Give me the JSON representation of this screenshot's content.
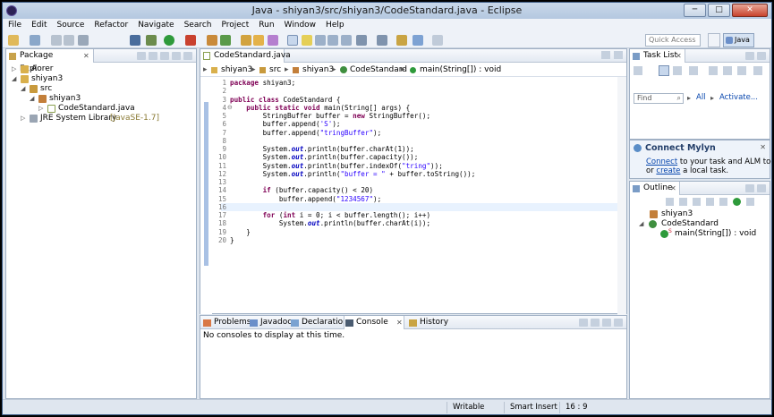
{
  "window": {
    "title": "Java - shiyan3/src/shiyan3/CodeStandard.java - Eclipse",
    "buttons": {
      "minimize": "─",
      "maximize": "□",
      "close": "✕"
    }
  },
  "menu": [
    "File",
    "Edit",
    "Source",
    "Refactor",
    "Navigate",
    "Search",
    "Project",
    "Run",
    "Window",
    "Help"
  ],
  "toolbar": {
    "quick_access_placeholder": "Quick Access",
    "perspective_label": "Java"
  },
  "package_explorer": {
    "title": "Package Explorer",
    "tree": [
      {
        "label": "A",
        "icon": "project-icon"
      },
      {
        "label": "shiyan3",
        "icon": "project-icon"
      },
      {
        "label": "src",
        "icon": "source-folder-icon"
      },
      {
        "label": "shiyan3",
        "icon": "package-icon"
      },
      {
        "label": "CodeStandard.java",
        "icon": "java-file-icon"
      },
      {
        "label": "JRE System Library",
        "suffix": "[JavaSE-1.7]",
        "icon": "library-icon"
      }
    ]
  },
  "editor": {
    "tab_label": "CodeStandard.java",
    "breadcrumb": [
      "shiyan3",
      "src",
      "shiyan3",
      "CodeStandard",
      "main(String[]) : void"
    ],
    "line_numbers": [
      "1",
      "2",
      "3",
      "4",
      "5",
      "6",
      "7",
      "8",
      "9",
      "10",
      "11",
      "12",
      "13",
      "14",
      "15",
      "16",
      "17",
      "18",
      "19",
      "20"
    ],
    "fold_marker_line": "4",
    "code": [
      "package shiyan3;",
      "",
      "public class CodeStandard {",
      "    public static void main(String[] args) {",
      "        StringBuffer buffer = new StringBuffer();",
      "        buffer.append('S');",
      "        buffer.append(\"tringBuffer\");",
      "",
      "        System.out.println(buffer.charAt(1));",
      "        System.out.println(buffer.capacity());",
      "        System.out.println(buffer.indexOf(\"tring\"));",
      "        System.out.println(\"buffer = \" + buffer.toString());",
      "",
      "        if (buffer.capacity() < 20)",
      "            buffer.append(\"1234567\");",
      "",
      "        for (int i = 0; i < buffer.length(); i++)",
      "            System.out.println(buffer.charAt(i));",
      "    }",
      "}"
    ]
  },
  "task_list": {
    "title": "Task List",
    "find_placeholder": "Find",
    "all_label": "All",
    "activate_label": "Activate..."
  },
  "mylyn": {
    "title": "Connect Mylyn",
    "connect_link": "Connect",
    "text_1": " to your task and ALM tools",
    "text_2a": "or ",
    "create_link": "create",
    "text_2b": " a local task."
  },
  "outline": {
    "title": "Outline",
    "items": [
      {
        "label": "shiyan3",
        "icon": "package-icon"
      },
      {
        "label": "CodeStandard",
        "icon": "class-icon"
      },
      {
        "label": "main(String[]) : void",
        "icon": "method-icon",
        "modifier": "S"
      }
    ]
  },
  "bottom_tabs": [
    "Problems",
    "Javadoc",
    "Declaration",
    "Console",
    "History"
  ],
  "console_message": "No consoles to display at this time.",
  "status": {
    "writable": "Writable",
    "insert_mode": "Smart Insert",
    "position": "16 : 9"
  },
  "colors": {
    "keyword": "#7f0055",
    "string": "#2a00ff",
    "static_field": "#0000c0",
    "selection_bar": "#a9c1e4"
  }
}
